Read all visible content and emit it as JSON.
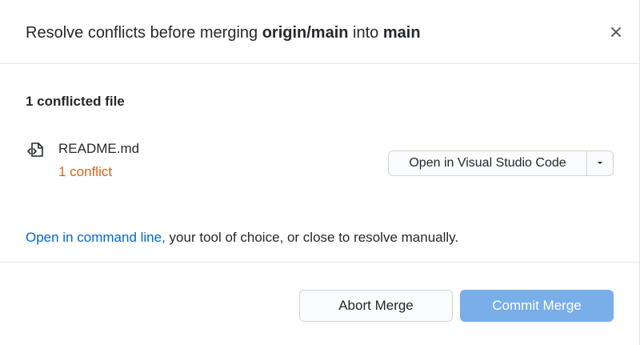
{
  "dialog": {
    "title_prefix": "Resolve conflicts before merging ",
    "title_source": "origin/main",
    "title_middle": " into ",
    "title_target": "main",
    "close_icon": "close-icon"
  },
  "body": {
    "conflict_count": "1 conflicted file",
    "files": [
      {
        "name": "README.md",
        "status": "1 conflict",
        "icon": "file-code-icon"
      }
    ],
    "open_button_label": "Open in Visual Studio Code",
    "dropdown_icon": "caret-down-icon",
    "hint_link": "Open in command line,",
    "hint_text": " your tool of choice, or close to resolve manually."
  },
  "footer": {
    "abort_label": "Abort Merge",
    "commit_label": "Commit Merge"
  },
  "colors": {
    "conflict": "#e16214",
    "link": "#0366d6",
    "primary_disabled": "#79aee9"
  }
}
